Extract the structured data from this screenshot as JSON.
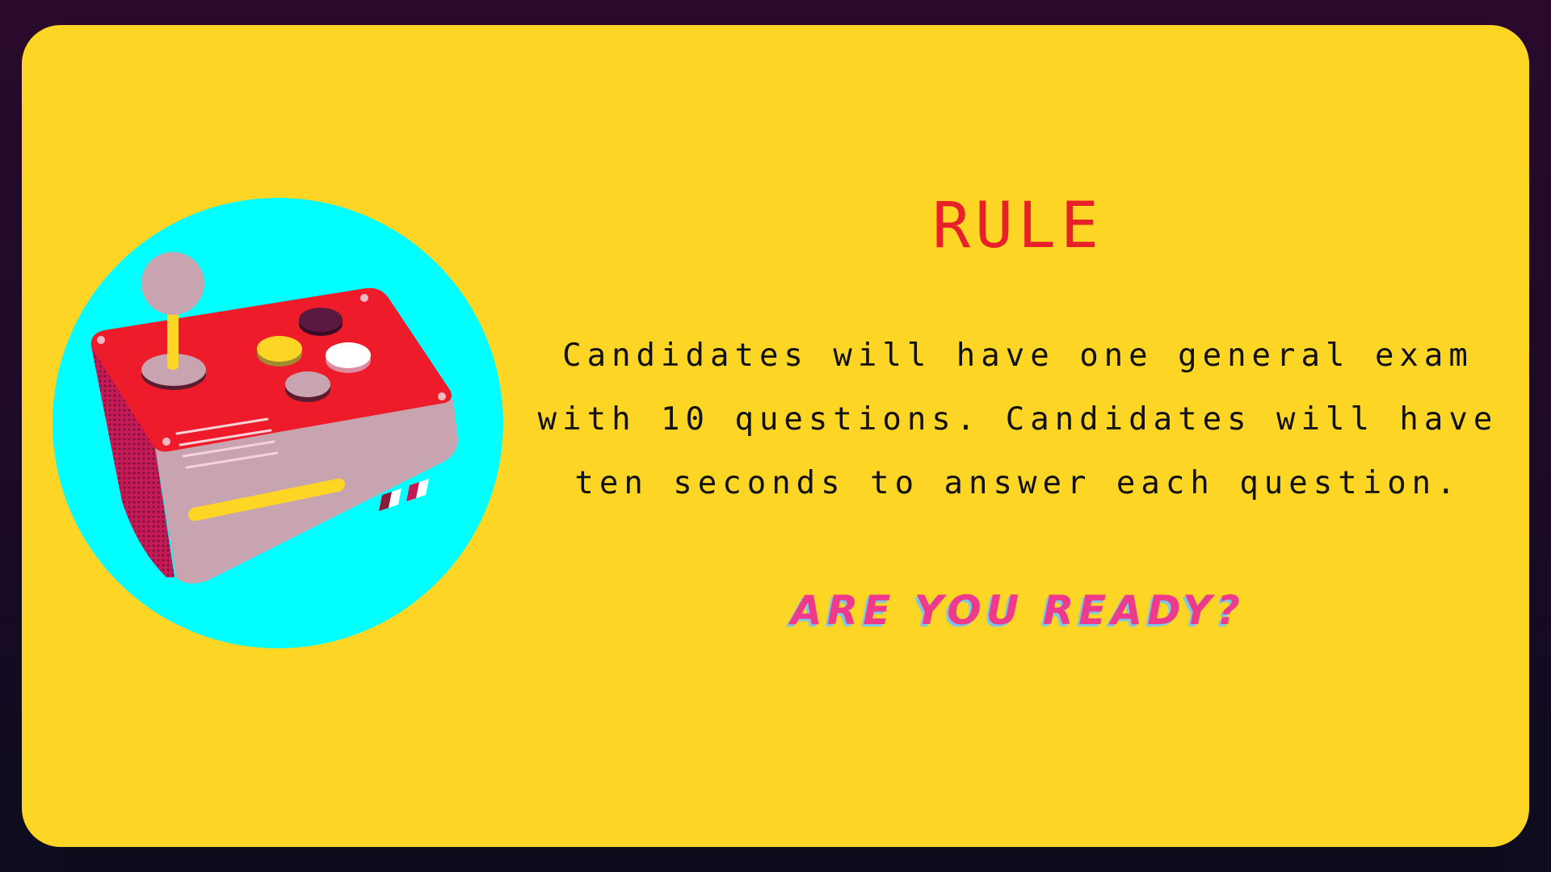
{
  "slide": {
    "title": "RULE",
    "body": "Candidates will have one general exam with 10 questions. Candidates will have ten seconds to answer each question.",
    "cta": "ARE YOU READY?"
  },
  "illustration": {
    "subject": "arcade-controller-icon"
  },
  "colors": {
    "frame_background": "#2a0a2c",
    "card_background": "#fdd525",
    "title": "#e8202a",
    "body_text": "#111111",
    "cta": "#ef3a8c",
    "cta_shadow": "#7cc8e6",
    "circle": "#00ffff",
    "controller_top": "#ee1c2a",
    "controller_side": "#c8a4b0"
  }
}
